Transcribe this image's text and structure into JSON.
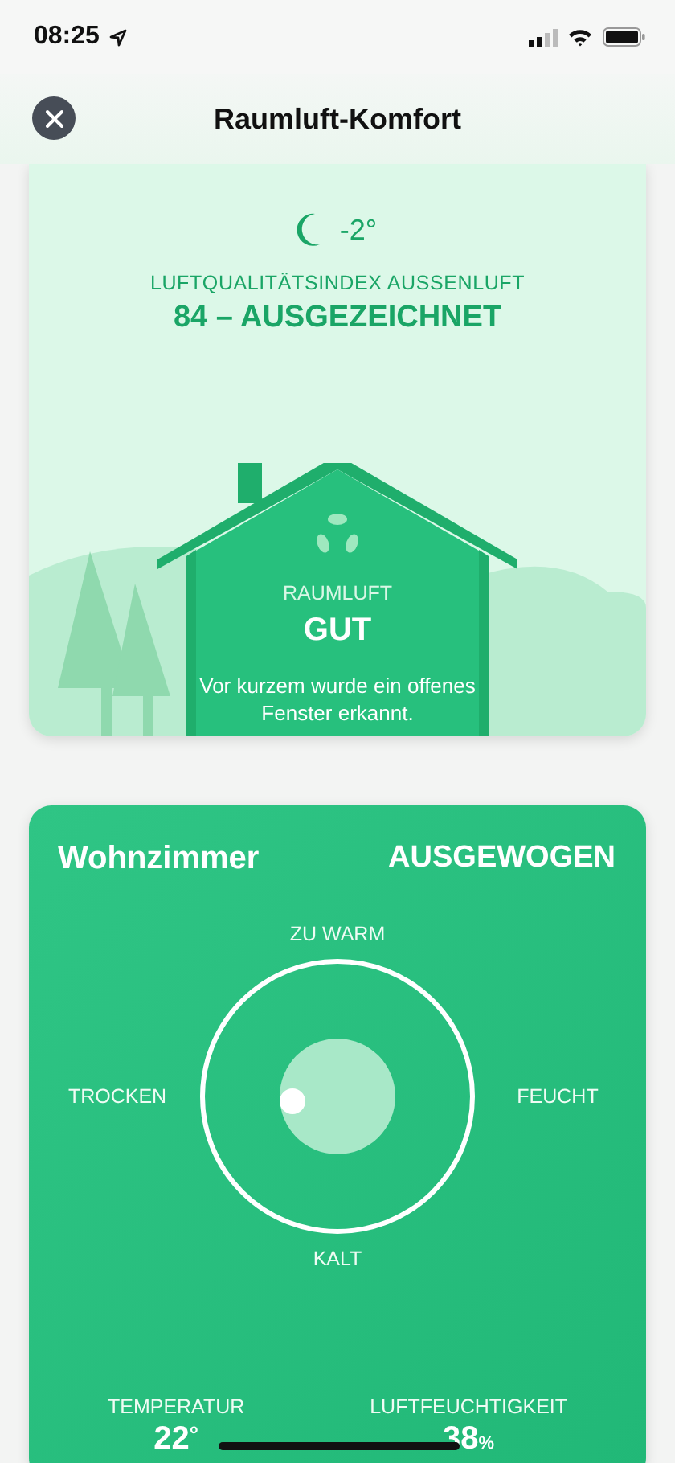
{
  "status_bar": {
    "time": "08:25"
  },
  "header": {
    "title": "Raumluft-Komfort"
  },
  "outdoor": {
    "temperature": "-2°",
    "label": "LUFTQUALITÄTSINDEX AUSSENLUFT",
    "value": "84 – AUSGEZEICHNET"
  },
  "indoor": {
    "label": "RAUMLUFT",
    "value": "GUT",
    "message": "Vor kurzem wurde ein offenes Fenster erkannt."
  },
  "room": {
    "name": "Wohnzimmer",
    "status": "AUSGEWOGEN",
    "axes": {
      "top": "ZU WARM",
      "left": "TROCKEN",
      "right": "FEUCHT",
      "bottom": "KALT"
    },
    "readings": [
      {
        "label": "TEMPERATUR",
        "value": "22",
        "unit": "°"
      },
      {
        "label": "LUFTFEUCHTIGKEIT",
        "value": "38",
        "unit": "%"
      }
    ]
  }
}
